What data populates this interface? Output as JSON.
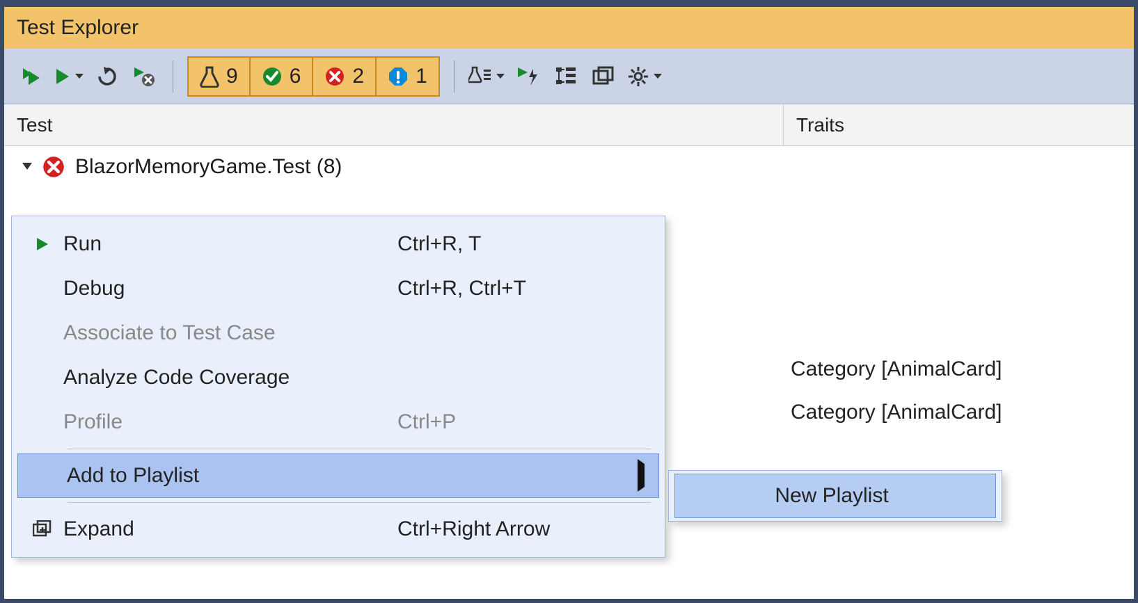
{
  "window": {
    "title": "Test Explorer"
  },
  "toolbar": {
    "summary": {
      "total": "9",
      "passed": "6",
      "failed": "2",
      "info": "1"
    }
  },
  "columns": {
    "test": "Test",
    "traits": "Traits"
  },
  "tree": {
    "root_label": "BlazorMemoryGame.Test  (8)"
  },
  "traits": {
    "row1": "Category [AnimalCard]",
    "row2": "Category [AnimalCard]"
  },
  "context_menu": {
    "run": {
      "label": "Run",
      "shortcut": "Ctrl+R, T"
    },
    "debug": {
      "label": "Debug",
      "shortcut": "Ctrl+R, Ctrl+T"
    },
    "associate": {
      "label": "Associate to Test Case"
    },
    "coverage": {
      "label": "Analyze Code Coverage"
    },
    "profile": {
      "label": "Profile",
      "shortcut": "Ctrl+P"
    },
    "add_playlist": {
      "label": "Add to Playlist"
    },
    "expand": {
      "label": "Expand",
      "shortcut": "Ctrl+Right Arrow"
    }
  },
  "submenu": {
    "new_playlist": {
      "label": "New Playlist"
    }
  }
}
